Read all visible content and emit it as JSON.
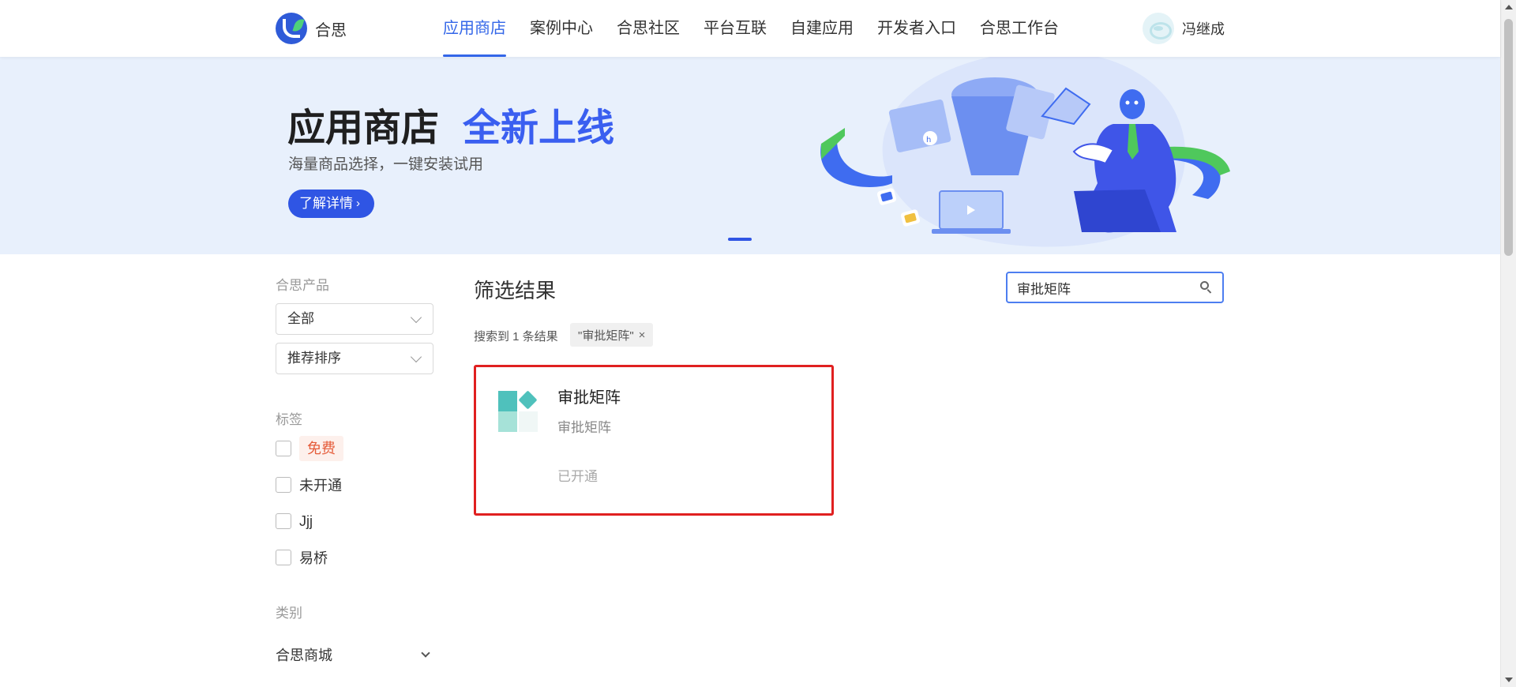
{
  "header": {
    "logo_text": "合思",
    "nav": [
      {
        "label": "应用商店",
        "active": true
      },
      {
        "label": "案例中心"
      },
      {
        "label": "合思社区"
      },
      {
        "label": "平台互联"
      },
      {
        "label": "自建应用"
      },
      {
        "label": "开发者入口"
      },
      {
        "label": "合思工作台"
      }
    ],
    "user_name": "冯继成"
  },
  "banner": {
    "title_main": "应用商店",
    "title_accent": "全新上线",
    "subtitle": "海量商品选择，一键安装试用",
    "button_label": "了解详情",
    "button_chevron": "›"
  },
  "sidebar": {
    "product_label": "合思产品",
    "product_select": "全部",
    "sort_select": "推荐排序",
    "tags_label": "标签",
    "tags": [
      "免费",
      "未开通",
      "Jjj",
      "易桥"
    ],
    "category_label": "类别",
    "category_item": "合思商城"
  },
  "results": {
    "title": "筛选结果",
    "search_value": "审批矩阵",
    "count_text": "搜索到 1 条结果",
    "chip_label": "\"审批矩阵\"",
    "chip_close": "×",
    "cards": [
      {
        "name": "审批矩阵",
        "desc": "审批矩阵",
        "status": "已开通"
      }
    ]
  },
  "colors": {
    "accent": "#3366e8",
    "banner_bg": "#e8f0fc",
    "highlight_border": "#e02020",
    "free_tag": "#e55c3a"
  }
}
